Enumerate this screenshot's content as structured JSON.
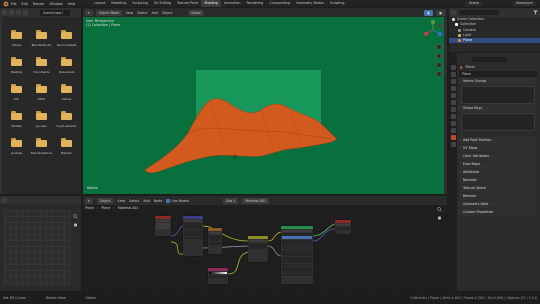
{
  "topbar": {
    "menus": [
      "File",
      "Edit",
      "Render",
      "Window",
      "Help"
    ],
    "workspaces": [
      "Layout",
      "Modeling",
      "Sculpting",
      "UV Editing",
      "Texture Paint",
      "Shading",
      "Animation",
      "Rendering",
      "Compositing",
      "Geometry Nodes",
      "Scripting"
    ],
    "active_workspace_index": 5,
    "scene": "Scene",
    "view_layer": "ViewLayer"
  },
  "filebrowser": {
    "path": "/home/user/",
    "folders": [
      "Unique",
      "BlenderStudio",
      "Source Assets",
      "Desktop",
      "Documents",
      "Downloads",
      "Koli",
      "HTML",
      "Games",
      "Utilities",
      "go-repo",
      "liquid-sampler",
      "youtube",
      "BlenderAddons",
      "Blender"
    ]
  },
  "viewport": {
    "mode": "Object Mode",
    "menus": [
      "View",
      "Select",
      "Add",
      "Object"
    ],
    "shading": "Global",
    "info_lines": [
      "User Perspective",
      "(1) Collection | Plane"
    ],
    "bottom_label": "Rotate",
    "colors": {
      "background": "#07703c",
      "plane": "#17985a",
      "mesh": "#d35a1f"
    }
  },
  "outliner": {
    "title": "Scene Collection",
    "rows": [
      {
        "label": "Scene Collection",
        "color": "#d0d0d0",
        "selected": false
      },
      {
        "label": "Collection",
        "color": "#ffffff",
        "selected": false
      },
      {
        "label": "Camera",
        "color": "#7f9f7f",
        "selected": false
      },
      {
        "label": "Light",
        "color": "#c8b06a",
        "selected": false
      },
      {
        "label": "Plane",
        "color": "#e08040",
        "selected": true
      }
    ]
  },
  "properties": {
    "object_name": "Plane",
    "material_field": "Plane",
    "sections": [
      "Vertex Groups",
      "Shape Keys"
    ],
    "panels": [
      "UV Maps",
      "Color Attributes",
      "Face Maps",
      "Attributes",
      "Normals",
      "Texture Space",
      "Remesh",
      "Geometry Data",
      "Custom Properties"
    ],
    "top_panel": "Add Rest Position"
  },
  "shader": {
    "editor_type": "Object",
    "menus": [
      "View",
      "Select",
      "Add",
      "Node"
    ],
    "use_nodes_label": "Use Nodes",
    "slot": "Slot 1",
    "material": "Material.001",
    "breadcrumb": [
      "Plane",
      "Plane",
      "Material.001"
    ]
  },
  "statusbar": {
    "left": [
      "Set 3D Cursor",
      "Rotate View",
      "Select"
    ],
    "right": "Collection | Plane | Verts:2,601 | Faces:2,500 | Tris:5,000 | Objects:1/3 | 3.5.0"
  }
}
